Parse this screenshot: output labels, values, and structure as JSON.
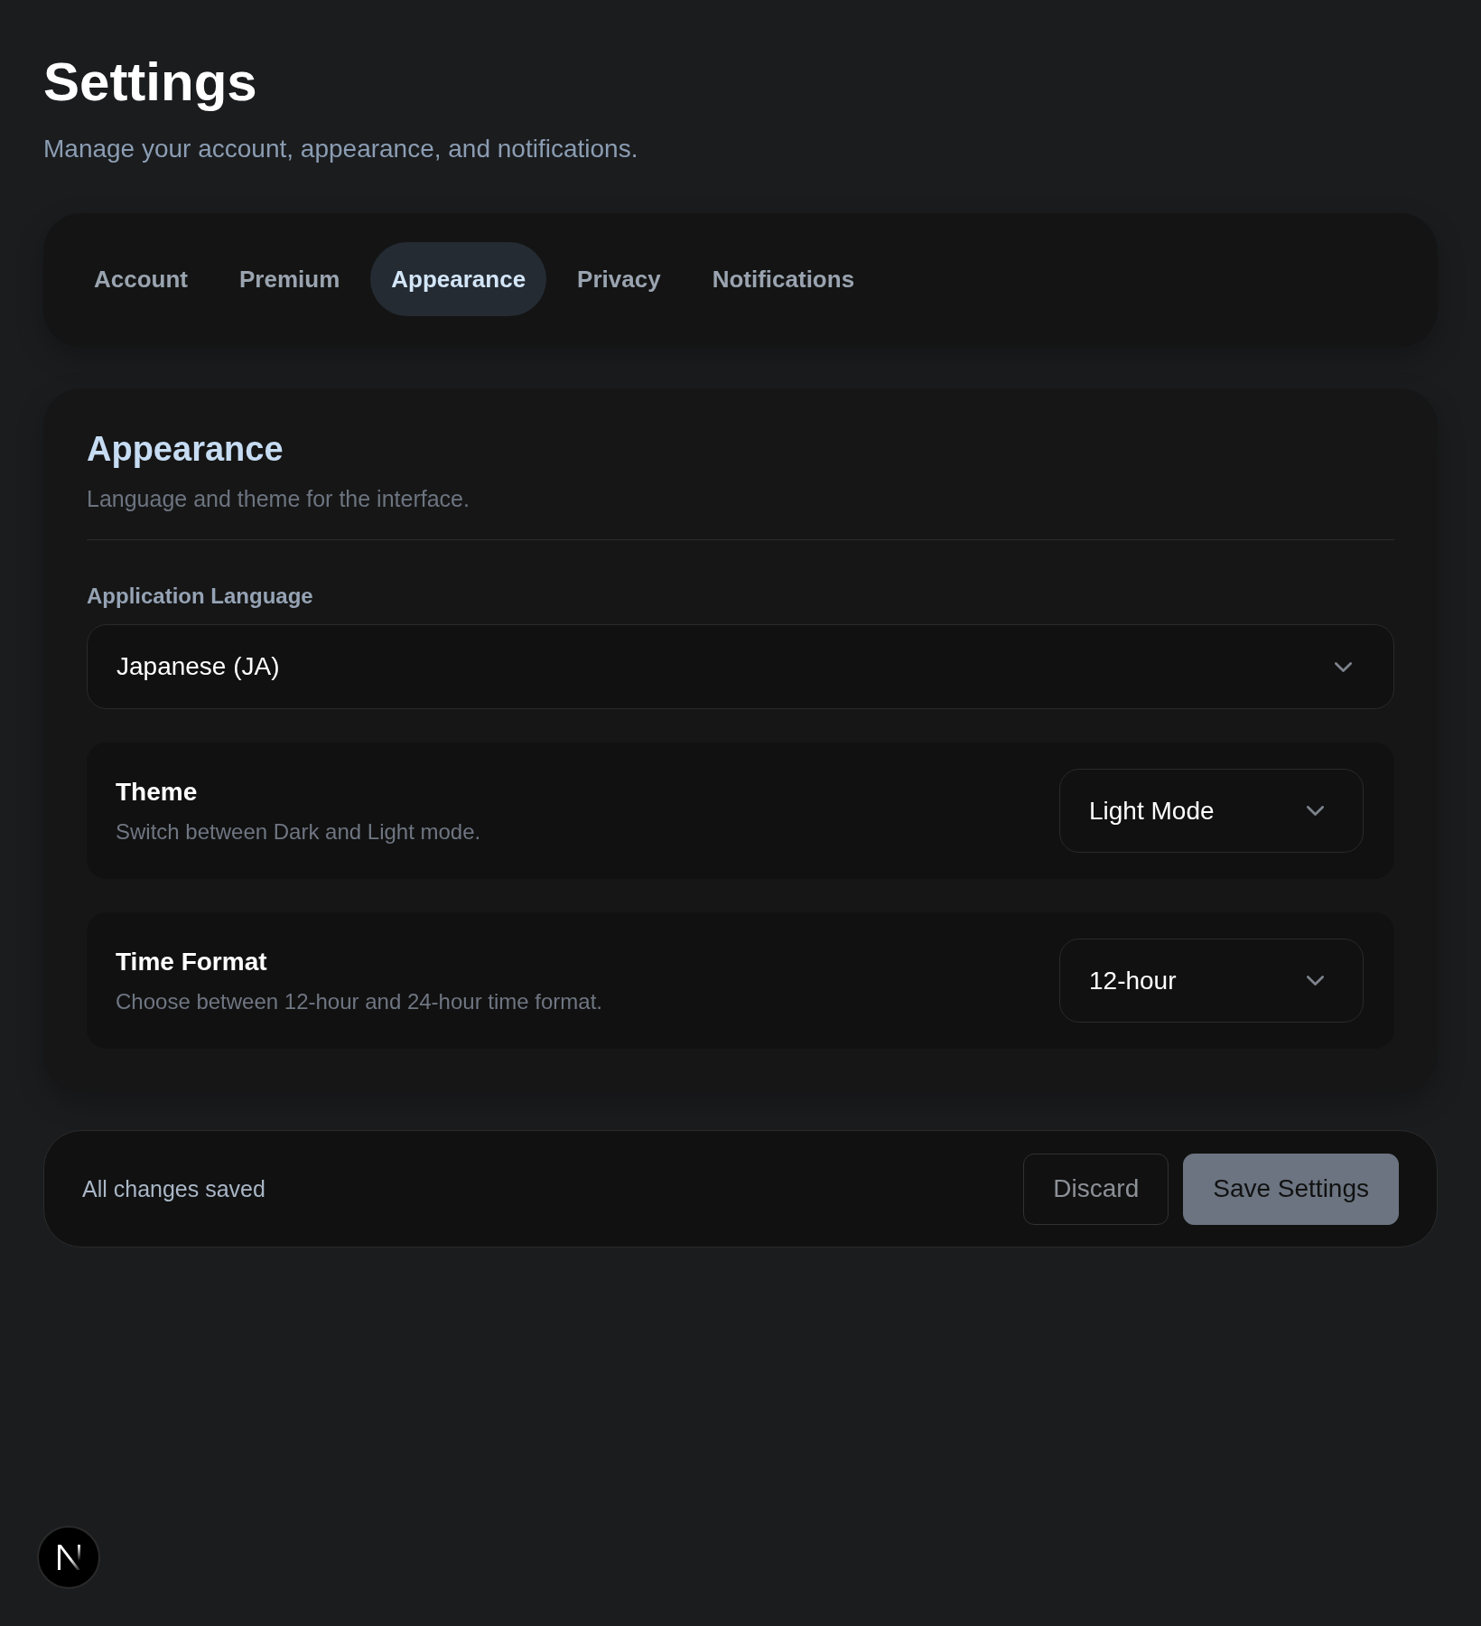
{
  "header": {
    "title": "Settings",
    "subtitle": "Manage your account, appearance, and notifications."
  },
  "tabs": [
    {
      "label": "Account",
      "selected": false
    },
    {
      "label": "Premium",
      "selected": false
    },
    {
      "label": "Appearance",
      "selected": true
    },
    {
      "label": "Privacy",
      "selected": false
    },
    {
      "label": "Notifications",
      "selected": false
    }
  ],
  "section": {
    "title": "Appearance",
    "description": "Language and theme for the interface.",
    "language": {
      "label": "Application Language",
      "value": "Japanese (JA)"
    },
    "settings": [
      {
        "title": "Theme",
        "description": "Switch between Dark and Light mode.",
        "value": "Light Mode"
      },
      {
        "title": "Time Format",
        "description": "Choose between 12-hour and 24-hour time format.",
        "value": "12-hour"
      }
    ]
  },
  "footer": {
    "status": "All changes saved",
    "buttons": [
      {
        "label": "Discard",
        "kind": "secondary"
      },
      {
        "label": "Save Settings",
        "kind": "primary"
      }
    ]
  }
}
